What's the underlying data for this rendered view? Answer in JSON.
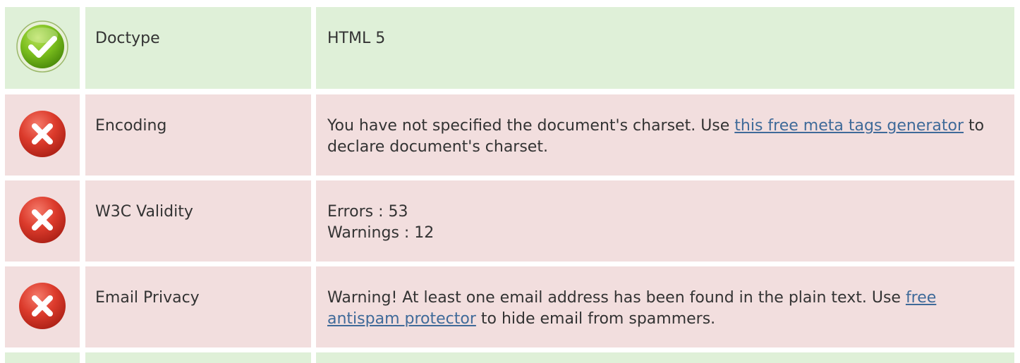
{
  "rows": [
    {
      "status": "pass",
      "icon": "check-circle-icon",
      "label": "Doctype",
      "text": "HTML 5"
    },
    {
      "status": "fail",
      "icon": "error-x-icon",
      "label": "Encoding",
      "text_before": "You have not specified the document's charset. Use ",
      "link": "this free meta tags generator",
      "text_after": " to declare document's charset."
    },
    {
      "status": "fail",
      "icon": "error-x-icon",
      "label": "W3C Validity",
      "line1": "Errors : 53",
      "line2": "Warnings : 12"
    },
    {
      "status": "fail",
      "icon": "error-x-icon",
      "label": "Email Privacy",
      "text_before": "Warning! At least one email address has been found in the plain text. Use ",
      "link": "free antispam protector",
      "text_after": " to hide email from spammers."
    },
    {
      "status": "pass",
      "icon": "",
      "label": "",
      "text": ""
    }
  ],
  "colors": {
    "pass_bg": "#dff0d8",
    "fail_bg": "#f2dede",
    "link": "#3f6a99",
    "text": "#333333"
  }
}
